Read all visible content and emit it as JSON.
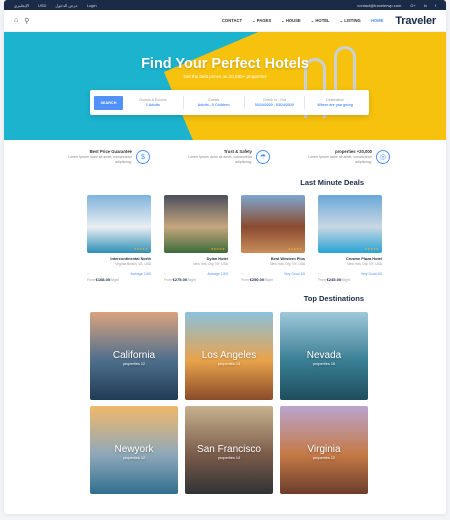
{
  "topbar": {
    "left": [
      "الإنجليزي",
      "USD",
      "عرض الدخول",
      "Login"
    ],
    "email": "contact@travelerwp.com",
    "social": [
      "G+",
      "in",
      "f"
    ]
  },
  "nav": {
    "items": [
      {
        "label": "CONTACT",
        "active": false
      },
      {
        "label": "PAGES",
        "active": false
      },
      {
        "label": "HOUSE",
        "active": false
      },
      {
        "label": "HOTEL",
        "active": false
      },
      {
        "label": "LISTING",
        "active": false
      },
      {
        "label": "HOME",
        "active": true
      }
    ],
    "brand": "Traveler"
  },
  "hero": {
    "title": "Find Your Perfect Hotels",
    "subtitle": "Get the best prices on 20,000+ properties",
    "search_button": "SEARCH",
    "fields": [
      {
        "label": "Guests & Rooms",
        "value": "1 Adults"
      },
      {
        "label": "Guests",
        "value": "Adults - 0 Children"
      },
      {
        "label": "Check In - Out",
        "value": "03/24/2020 - 03/24/2020"
      },
      {
        "label": "Destination",
        "value": "Where are you going"
      }
    ]
  },
  "features": [
    {
      "title": "Best Price Guarantee",
      "text": "Lorem ipsum dolor sit amet, consectetur adipiscing.",
      "icon": "piggy-bank-icon"
    },
    {
      "title": "Trust & Safety",
      "text": "Lorem ipsum dolor sit amet, consectetur adipiscing.",
      "icon": "umbrella-icon"
    },
    {
      "title": "properties +20,000",
      "text": "Lorem ipsum dolor sit amet, consectetur adipiscing.",
      "icon": "globe-icon"
    }
  ],
  "deals": {
    "title": "Last Minute Deals",
    "items": [
      {
        "name": "Intercontinental North",
        "address": "Virginia Beach, VA, USA",
        "reviews": "Average 2.5/5",
        "price": "€108.00",
        "unit": "/Night",
        "colors": [
          "#7fb3dc",
          "#e9eef2",
          "#2e8fb8"
        ]
      },
      {
        "name": "Dylan Hotel",
        "address": "New York City, NY, USA",
        "reviews": "Average 2.5/5",
        "price": "€275.00",
        "unit": "/Night",
        "colors": [
          "#4a4f5c",
          "#c6a77f",
          "#3e6b3a"
        ]
      },
      {
        "name": "Best Western Plus",
        "address": "New York City, NY, USA",
        "reviews": "Very Good 4/5",
        "price": "€250.00",
        "unit": "/Night",
        "colors": [
          "#7ea6cf",
          "#8a4b2f",
          "#c88e5c"
        ]
      },
      {
        "name": "Crowne Plaza Hotel",
        "address": "New York City, NY, USA",
        "reviews": "Very Good 4/5",
        "price": "€245.00",
        "unit": "/Night",
        "colors": [
          "#6ba7d8",
          "#c9d7e3",
          "#28a3d6"
        ]
      }
    ],
    "from_label": "From",
    "stars": "★★★★★"
  },
  "destinations": {
    "title": "Top Destinations",
    "items": [
      {
        "name": "California",
        "properties": "properties 12",
        "colors": [
          "#d9a37e",
          "#4e6f8c",
          "#203a54"
        ]
      },
      {
        "name": "Los Angeles",
        "properties": "properties 14",
        "colors": [
          "#8bc1dd",
          "#e9a34b",
          "#8a4b2a"
        ]
      },
      {
        "name": "Nevada",
        "properties": "properties 16",
        "colors": [
          "#9fc7d9",
          "#3a7f95",
          "#1d4d5c"
        ]
      },
      {
        "name": "Newyork",
        "properties": "properties 12",
        "colors": [
          "#f0b86a",
          "#8fa8b9",
          "#2f6f8e"
        ]
      },
      {
        "name": "San Francisco",
        "properties": "properties 14",
        "colors": [
          "#c6b28e",
          "#7b5c4a",
          "#2f3236"
        ]
      },
      {
        "name": "Virginia",
        "properties": "properties 12",
        "colors": [
          "#b9a4cf",
          "#c57a46",
          "#6c3d2c"
        ]
      }
    ]
  },
  "colors": {
    "primary": "#5191fa",
    "dark": "#1a2b48",
    "pool": "#1cb3cf",
    "deck": "#f6c20d"
  }
}
